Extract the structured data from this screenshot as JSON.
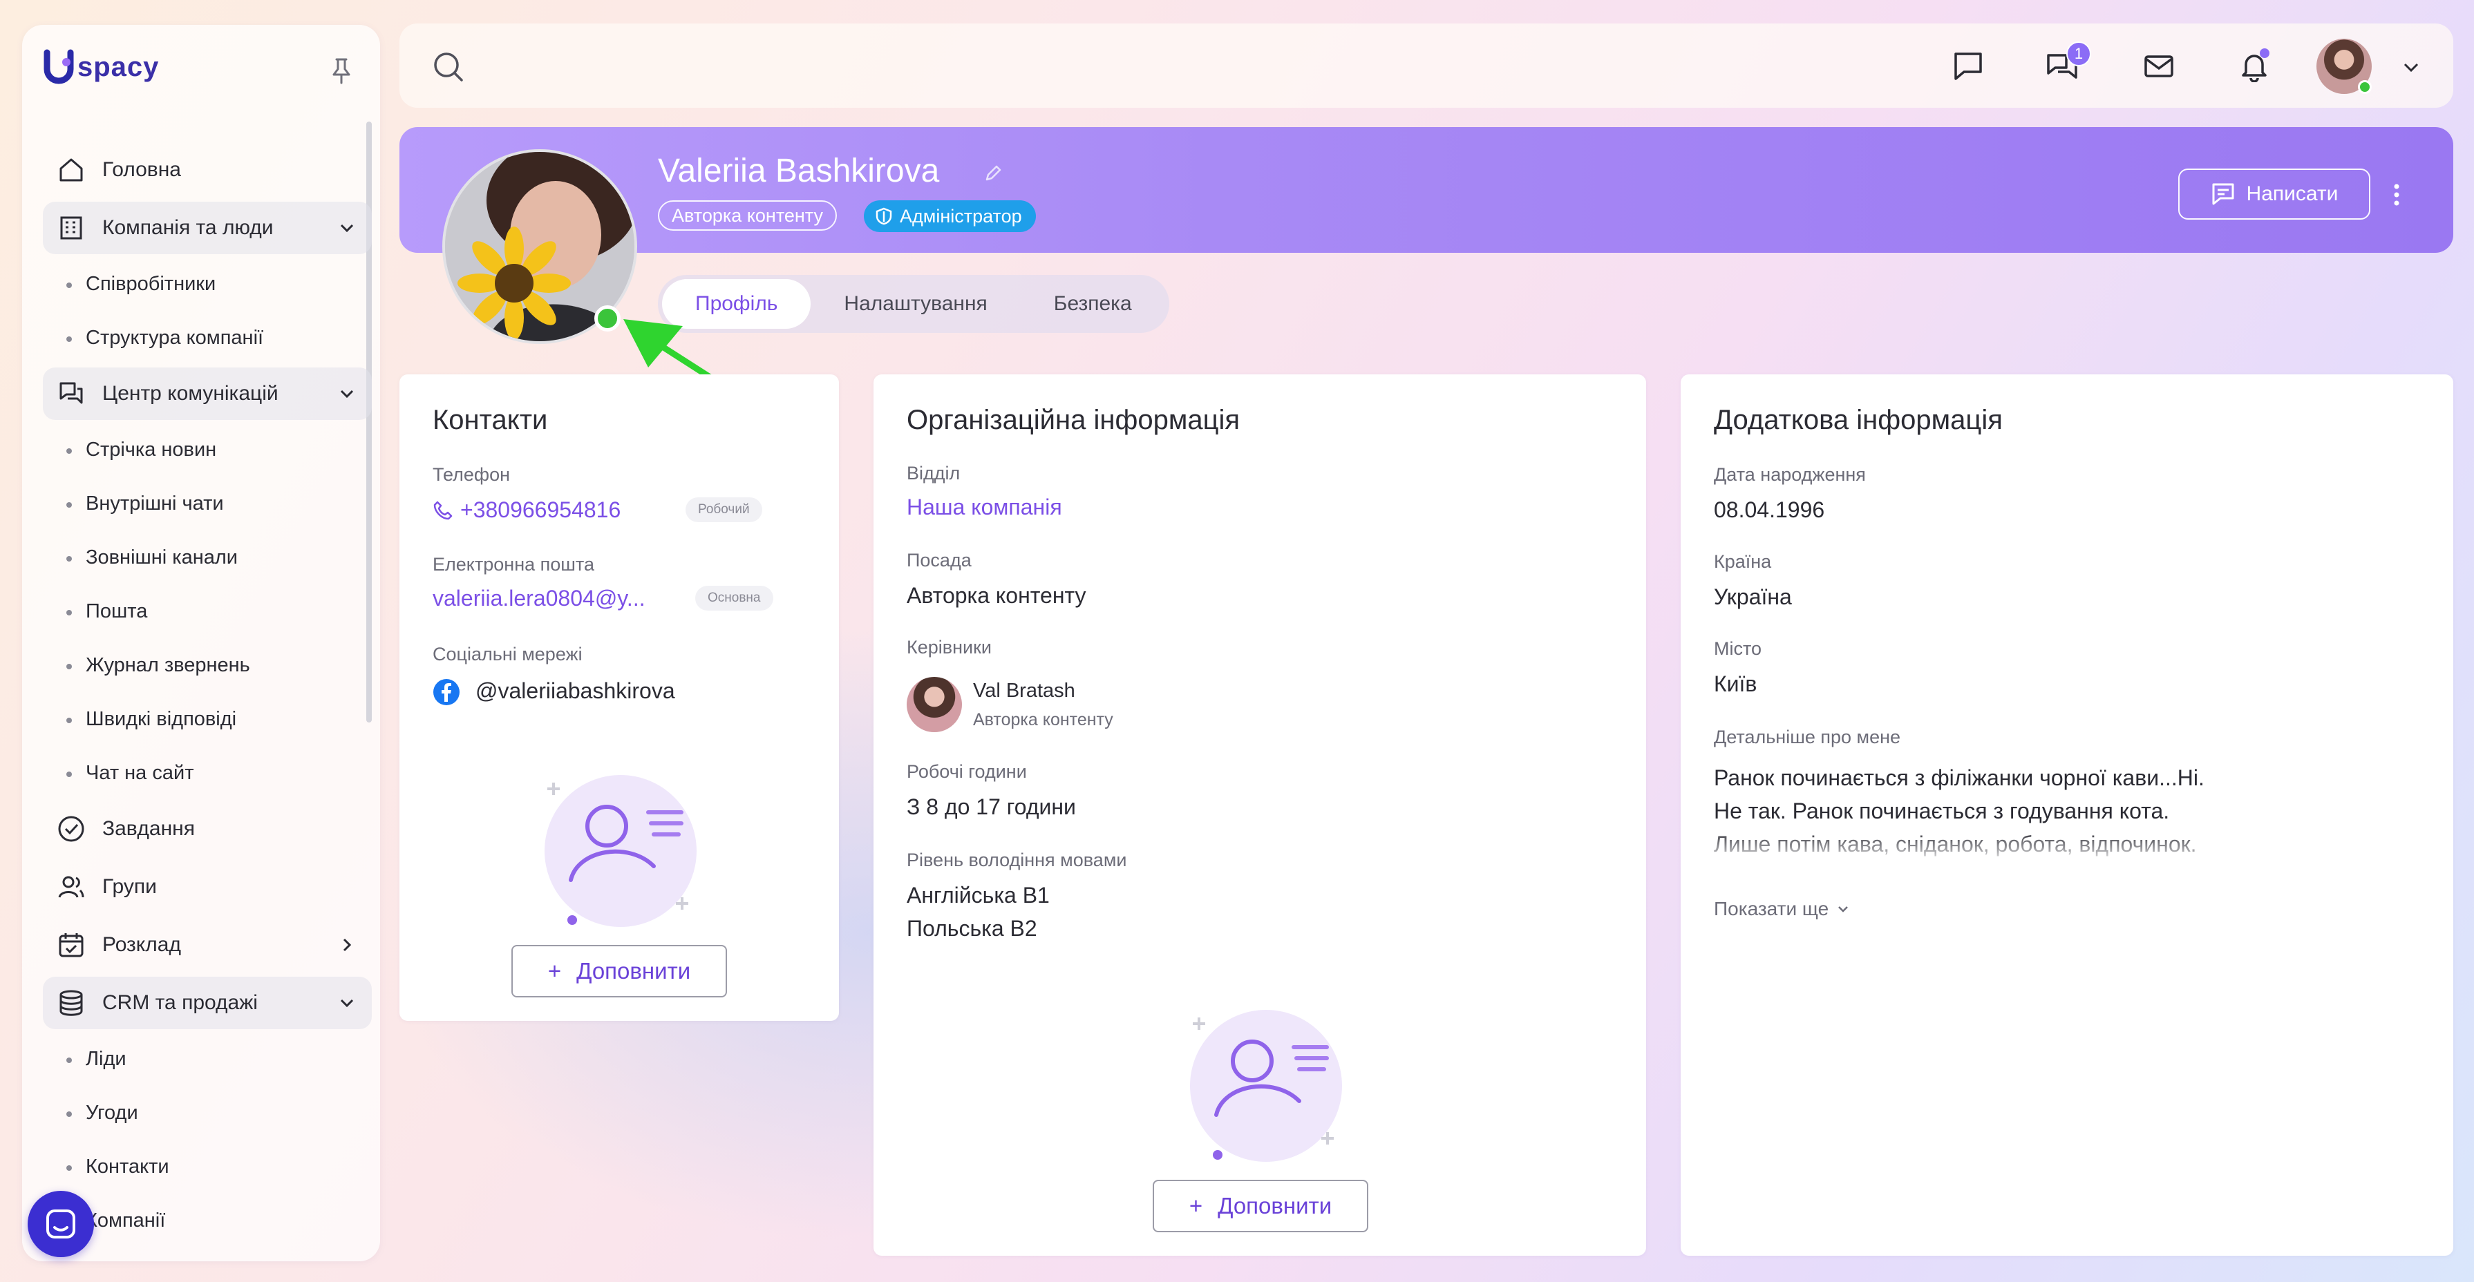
{
  "app": {
    "logo_text": "spacy",
    "logo_letter": "U"
  },
  "sidebar": {
    "items": [
      {
        "label": "Головна",
        "icon": "home-icon"
      },
      {
        "label": "Компанія та люди",
        "icon": "building-icon",
        "expanded": true,
        "children": [
          "Співробітники",
          "Структура компанії"
        ]
      },
      {
        "label": "Центр комунікацій",
        "icon": "chat-hub-icon",
        "expanded": true,
        "children": [
          "Стрічка новин",
          "Внутрішні чати",
          "Зовнішні канали",
          "Пошта",
          "Журнал звернень",
          "Швидкі відповіді",
          "Чат на сайт"
        ]
      },
      {
        "label": "Завдання",
        "icon": "check-circle-icon"
      },
      {
        "label": "Групи",
        "icon": "group-icon"
      },
      {
        "label": "Розклад",
        "icon": "calendar-icon",
        "expanded": false
      },
      {
        "label": "CRM та продажі",
        "icon": "database-icon",
        "expanded": true,
        "children": [
          "Ліди",
          "Угоди",
          "Контакти",
          "Компанії"
        ]
      }
    ]
  },
  "topbar": {
    "chat_badge": "1"
  },
  "profile": {
    "name": "Valeriia Bashkirova",
    "role": "Авторка контенту",
    "admin_badge": "Адміністратор",
    "write_button": "Написати",
    "tabs": [
      {
        "label": "Профіль",
        "active": true
      },
      {
        "label": "Налаштування",
        "active": false
      },
      {
        "label": "Безпека",
        "active": false
      }
    ]
  },
  "contacts": {
    "title": "Контакти",
    "phone_label": "Телефон",
    "phone": "+380966954816",
    "phone_tag": "Робочий",
    "email_label": "Електронна пошта",
    "email": "valeriia.lera0804@y...",
    "email_tag": "Основна",
    "social_label": "Соціальні мережі",
    "social": "@valeriiabashkirova",
    "add_button": "Доповнити"
  },
  "org": {
    "title": "Організаційна інформація",
    "dept_label": "Відділ",
    "dept": "Наша компанія",
    "position_label": "Посада",
    "position": "Авторка контенту",
    "managers_label": "Керівники",
    "manager_name": "Val Bratash",
    "manager_role": "Авторка контенту",
    "hours_label": "Робочі години",
    "hours": "З 8 до 17 години",
    "languages_label": "Рівень володіння мовами",
    "languages": [
      "Англійська B1",
      "Польська B2"
    ],
    "add_button": "Доповнити"
  },
  "extra": {
    "title": "Додаткова інформація",
    "birth_label": "Дата народження",
    "birth": "08.04.1996",
    "country_label": "Країна",
    "country": "Україна",
    "city_label": "Місто",
    "city": "Київ",
    "about_label": "Детальніше про мене",
    "about": "Ранок починається з філіжанки чорної кави...Ні. Не так. Ранок починається з годування кота. Лише потім кава, сніданок, робота, відпочинок. Вечір. Знову час",
    "show_more": "Показати ще"
  },
  "colors": {
    "accent": "#7b4fe6",
    "banner": "#a88af5",
    "admin": "#1f9fea",
    "online": "#3bc43b",
    "arrow": "#2fd42f"
  }
}
